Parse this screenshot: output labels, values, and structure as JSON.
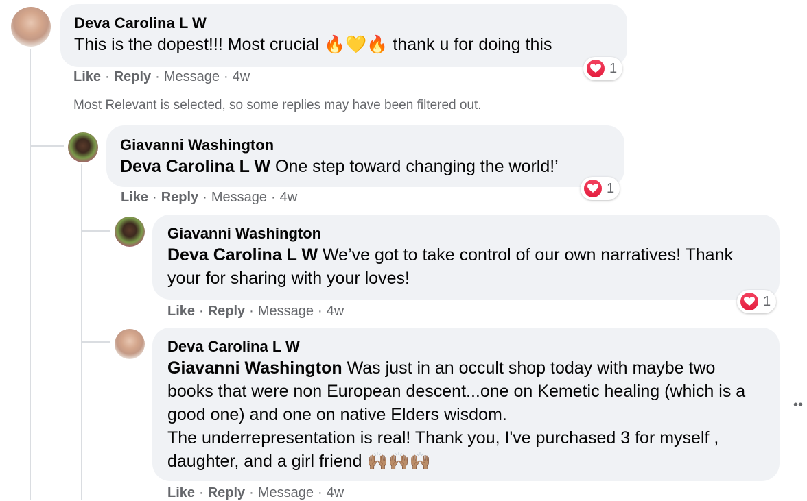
{
  "comments": [
    {
      "author": "Deva Carolina L W",
      "text": "This is the dopest!!! Most crucial 🔥💛🔥 thank u for doing this",
      "actions": {
        "like": "Like",
        "reply": "Reply",
        "message": "Message",
        "time": "4w"
      },
      "reaction_count": "1"
    },
    {
      "author": "Giavanni Washington",
      "mention": "Deva Carolina L W",
      "text": " One step toward changing the world!’",
      "actions": {
        "like": "Like",
        "reply": "Reply",
        "message": "Message",
        "time": "4w"
      },
      "reaction_count": "1"
    },
    {
      "author": "Giavanni Washington",
      "mention": "Deva Carolina L W",
      "text": " We’ve got to take control of our own narratives! Thank your for sharing with your loves!",
      "actions": {
        "like": "Like",
        "reply": "Reply",
        "message": "Message",
        "time": "4w"
      },
      "reaction_count": "1"
    },
    {
      "author": "Deva Carolina L W",
      "mention": "Giavanni Washington",
      "text": " Was just in an occult shop today with maybe two books that were non European descent...one on Kemetic healing (which is a good one) and one on native Elders wisdom.",
      "text2": "The underrepresentation is real! Thank you, I've purchased 3 for myself , daughter, and a girl friend 🙌🏽🙌🏽🙌🏽",
      "actions": {
        "like": "Like",
        "reply": "Reply",
        "message": "Message",
        "time": "4w"
      }
    }
  ],
  "filter_notice": "Most Relevant is selected, so some replies may have been filtered out.",
  "separator": "·",
  "colors": {
    "bubble": "#f0f2f5",
    "meta": "#65676b",
    "love": "#f3425f"
  }
}
